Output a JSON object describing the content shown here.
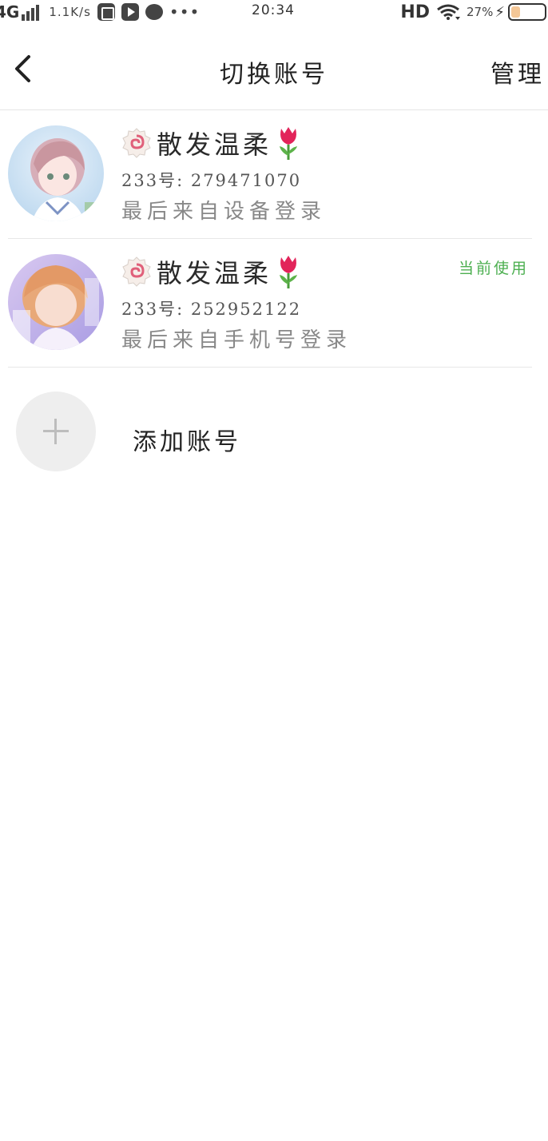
{
  "status_bar": {
    "network": "4G",
    "speed": "1.1K/s",
    "time": "20:34",
    "hd": "HD",
    "battery_pct": "27%",
    "battery_level": 0.27,
    "icons": [
      "signal-icon",
      "screenshot-icon",
      "media-play-icon",
      "chat-bubble-icon",
      "more-dots-icon",
      "wifi-icon",
      "charging-bolt-icon",
      "battery-icon"
    ]
  },
  "nav": {
    "title": "切换账号",
    "manage": "管理"
  },
  "accounts": [
    {
      "name": "散发温柔",
      "id_text": "233号: 279471070",
      "login_text": "最后来自设备登录",
      "current": ""
    },
    {
      "name": "散发温柔",
      "id_text": "233号: 252952122",
      "login_text": "最后来自手机号登录",
      "current": "当前使用"
    }
  ],
  "add_account": {
    "label": "添加账号"
  },
  "colors": {
    "accent_green": "#4caf50",
    "divider": "#e8e8e8",
    "secondary_text": "#888888"
  }
}
